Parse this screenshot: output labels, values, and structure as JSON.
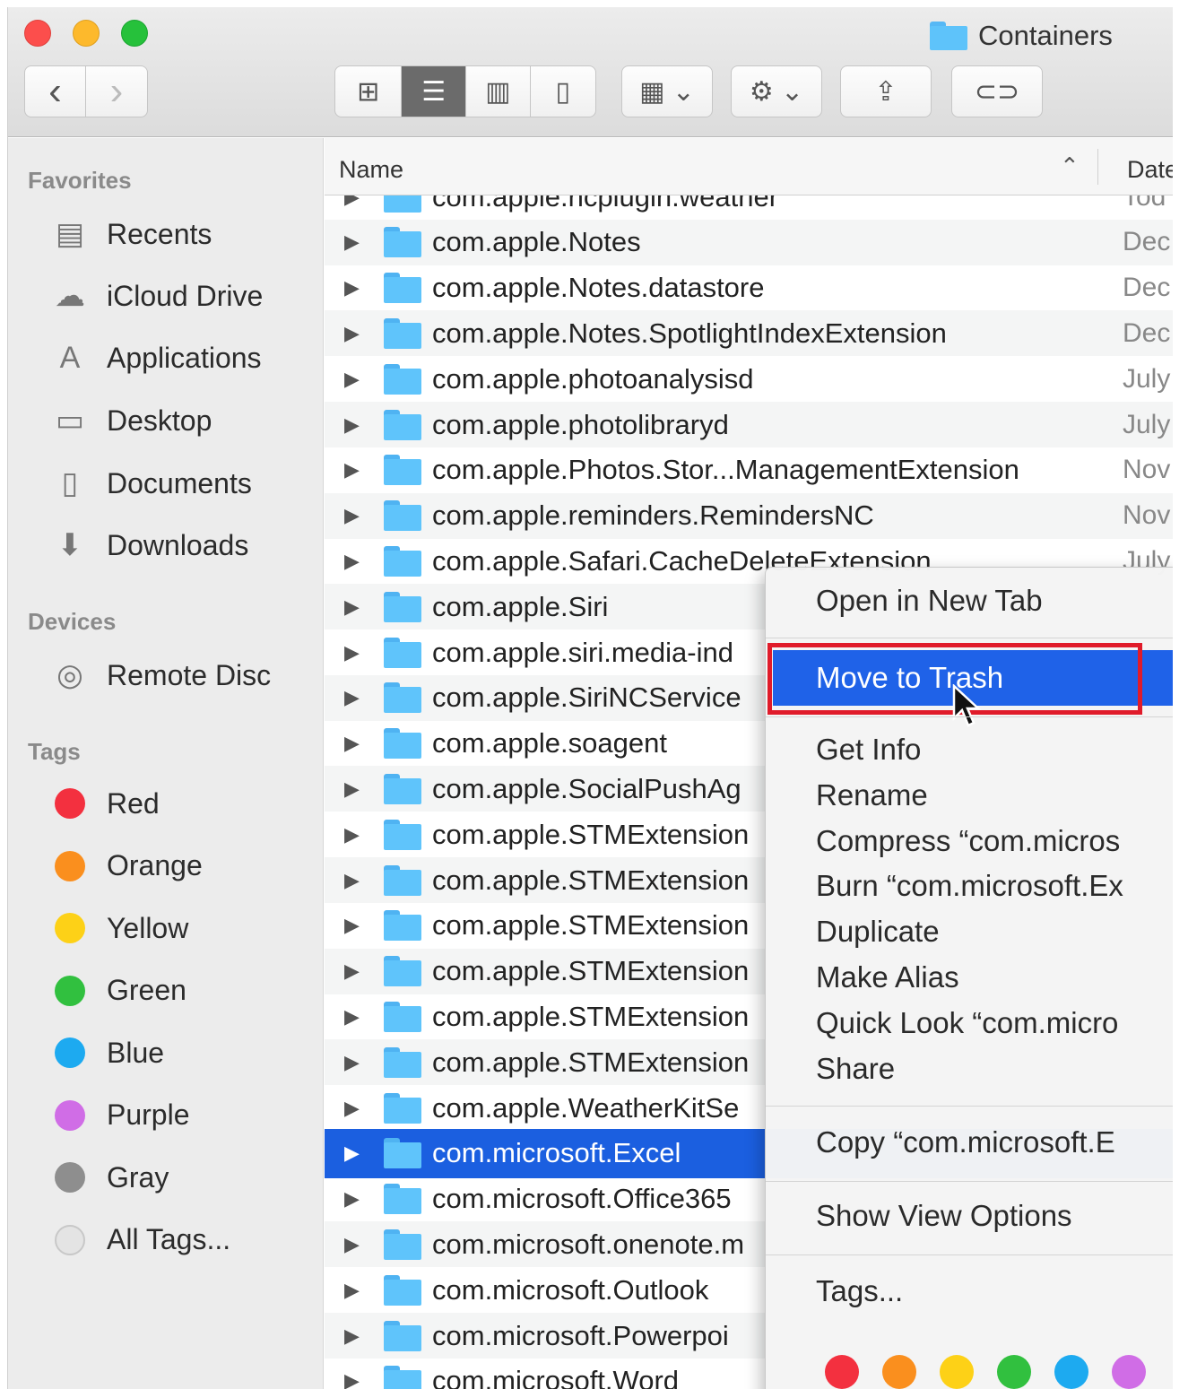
{
  "window": {
    "title": "Containers",
    "traffic_colors": [
      "#fc4e4c",
      "#fdb92c",
      "#26c13b"
    ]
  },
  "toolbar": {
    "back": "‹",
    "forward": "›",
    "view_icons": "⊞",
    "view_list": "☰",
    "view_columns": "▥",
    "view_gallery": "▯",
    "group": "▦ ⌄",
    "action": "⚙ ⌄",
    "share": "⇪",
    "tags": "⊂⊃"
  },
  "sidebar": {
    "favorites_label": "Favorites",
    "favorites": [
      {
        "label": "Recents",
        "icon": "recents-icon",
        "glyph": "▤"
      },
      {
        "label": "iCloud Drive",
        "icon": "cloud-icon",
        "glyph": "☁"
      },
      {
        "label": "Applications",
        "icon": "applications-icon",
        "glyph": "A"
      },
      {
        "label": "Desktop",
        "icon": "desktop-icon",
        "glyph": "▭"
      },
      {
        "label": "Documents",
        "icon": "documents-icon",
        "glyph": "▯"
      },
      {
        "label": "Downloads",
        "icon": "downloads-icon",
        "glyph": "⬇"
      }
    ],
    "devices_label": "Devices",
    "devices": [
      {
        "label": "Remote Disc",
        "icon": "disc-icon",
        "glyph": "◎"
      }
    ],
    "tags_label": "Tags",
    "tags": [
      {
        "label": "Red",
        "color": "#f3303f"
      },
      {
        "label": "Orange",
        "color": "#fa8f1e"
      },
      {
        "label": "Yellow",
        "color": "#fdd117"
      },
      {
        "label": "Green",
        "color": "#31c03f"
      },
      {
        "label": "Blue",
        "color": "#1daaf0"
      },
      {
        "label": "Purple",
        "color": "#d06de6"
      },
      {
        "label": "Gray",
        "color": "#8e8e8e"
      },
      {
        "label": "All Tags...",
        "color": "#e4e4e4"
      }
    ]
  },
  "list": {
    "col_name": "Name",
    "col_date": "Date",
    "sort_glyph": "⌃",
    "rows": [
      {
        "name": "com.apple.ncplugin.weather",
        "date": "Tod"
      },
      {
        "name": "com.apple.Notes",
        "date": "Dec"
      },
      {
        "name": "com.apple.Notes.datastore",
        "date": "Dec"
      },
      {
        "name": "com.apple.Notes.SpotlightIndexExtension",
        "date": "Dec"
      },
      {
        "name": "com.apple.photoanalysisd",
        "date": "July"
      },
      {
        "name": "com.apple.photolibraryd",
        "date": "July"
      },
      {
        "name": "com.apple.Photos.Stor...ManagementExtension",
        "date": "Nov"
      },
      {
        "name": "com.apple.reminders.RemindersNC",
        "date": "Nov"
      },
      {
        "name": "com.apple.Safari.CacheDeleteExtension",
        "date": "July"
      },
      {
        "name": "com.apple.Siri",
        "date": ""
      },
      {
        "name": "com.apple.siri.media-ind",
        "date": ""
      },
      {
        "name": "com.apple.SiriNCService",
        "date": ""
      },
      {
        "name": "com.apple.soagent",
        "date": ""
      },
      {
        "name": "com.apple.SocialPushAg",
        "date": ""
      },
      {
        "name": "com.apple.STMExtension",
        "date": ""
      },
      {
        "name": "com.apple.STMExtension",
        "date": ""
      },
      {
        "name": "com.apple.STMExtension",
        "date": ""
      },
      {
        "name": "com.apple.STMExtension",
        "date": ""
      },
      {
        "name": "com.apple.STMExtension",
        "date": ""
      },
      {
        "name": "com.apple.STMExtension",
        "date": ""
      },
      {
        "name": "com.apple.WeatherKitSe",
        "date": ""
      },
      {
        "name": "com.microsoft.Excel",
        "date": "",
        "selected": true
      },
      {
        "name": "com.microsoft.Office365",
        "date": ""
      },
      {
        "name": "com.microsoft.onenote.m",
        "date": ""
      },
      {
        "name": "com.microsoft.Outlook",
        "date": ""
      },
      {
        "name": "com.microsoft.Powerpoi",
        "date": ""
      },
      {
        "name": "com.microsoft.Word",
        "date": ""
      }
    ]
  },
  "context_menu": {
    "open_new_tab": "Open in New Tab",
    "move_to_trash": "Move to Trash",
    "get_info": "Get Info",
    "rename": "Rename",
    "compress": "Compress “com.micros",
    "burn": "Burn “com.microsoft.Ex",
    "duplicate": "Duplicate",
    "make_alias": "Make Alias",
    "quick_look": "Quick Look “com.micro",
    "share": "Share",
    "copy": "Copy “com.microsoft.E",
    "show_view_options": "Show View Options",
    "tags": "Tags...",
    "tag_colors": [
      "#f3303f",
      "#fa8f1e",
      "#fdd117",
      "#31c03f",
      "#1daaf0",
      "#d06de6"
    ],
    "highlight_color": "#1f62e8",
    "annotation_color": "#e01b2a"
  }
}
